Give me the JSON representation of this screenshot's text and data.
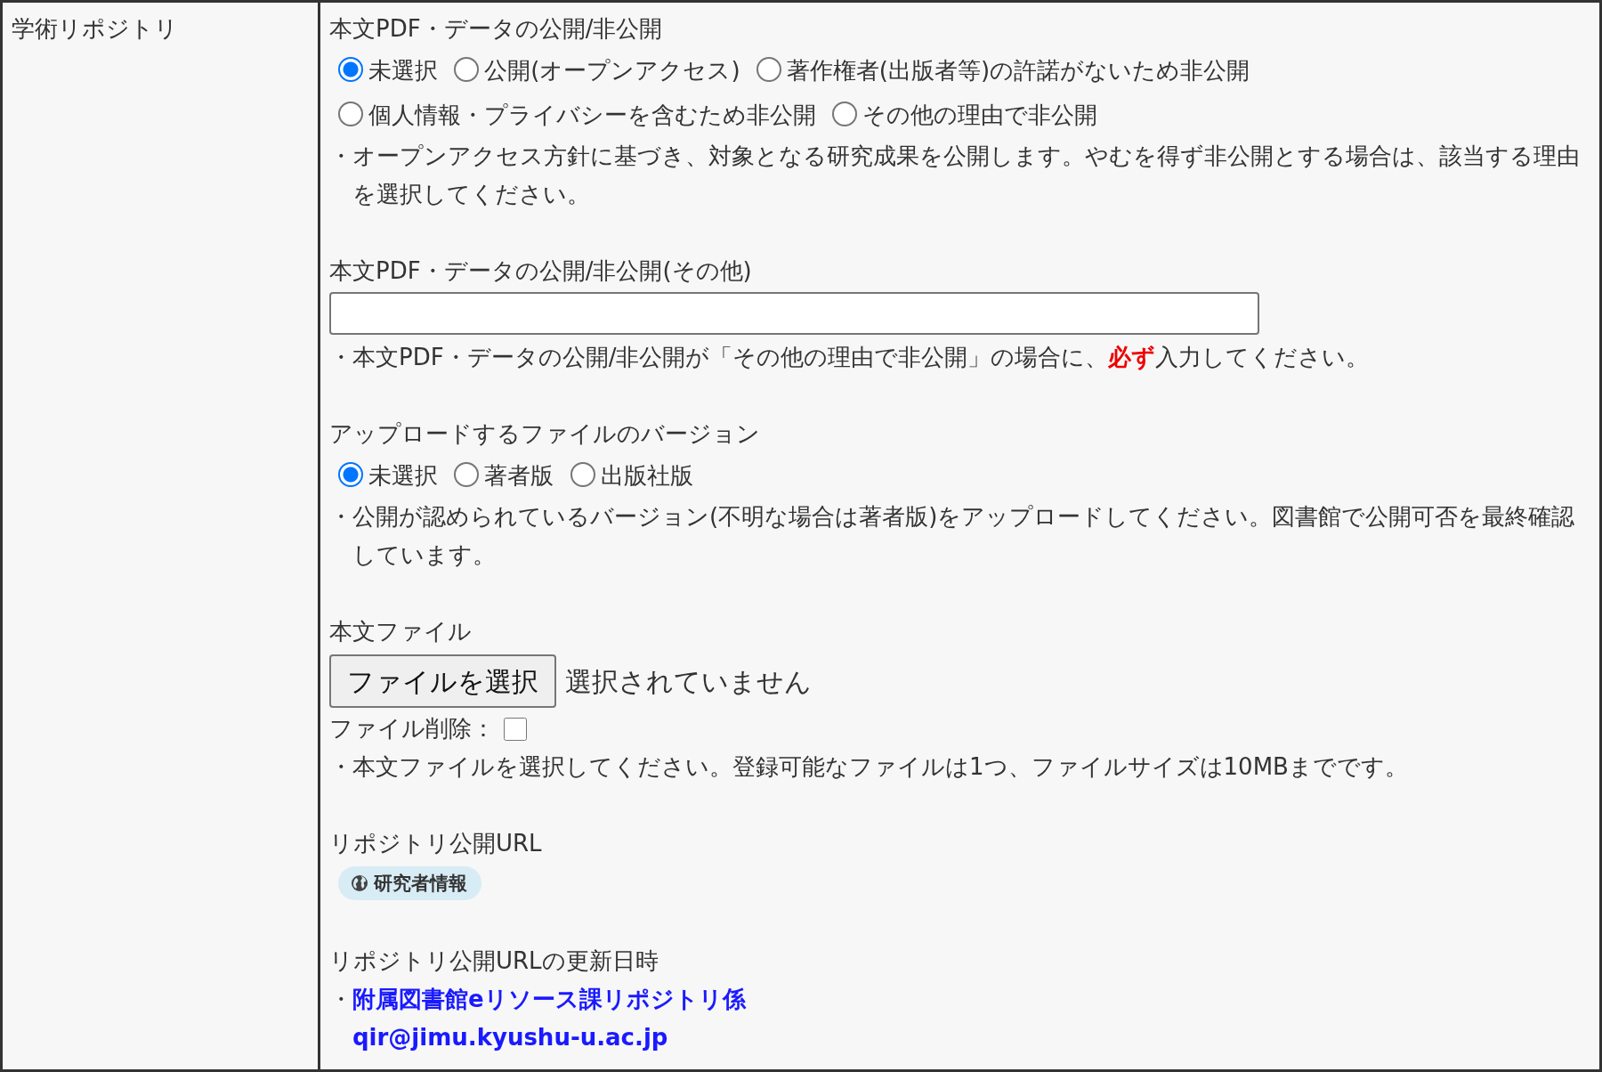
{
  "row_label": "学術リポジトリ",
  "sections": [
    {
      "kind": "radios",
      "title": "本文PDF・データの公開/非公開",
      "options": [
        {
          "label": "未選択",
          "selected": true
        },
        {
          "label": "公開(オープンアクセス)",
          "selected": false
        },
        {
          "label": "著作権者(出版者等)の許諾がないため非公開",
          "selected": false
        },
        {
          "label": "個人情報・プライバシーを含むため非公開",
          "selected": false
        },
        {
          "label": "その他の理由で非公開",
          "selected": false
        }
      ],
      "notes": [
        "・オープンアクセス方針に基づき、対象となる研究成果を公開します。やむを得ず非公開とする場合は、該当する理由を選択してください。"
      ]
    },
    {
      "kind": "text",
      "title": "本文PDF・データの公開/非公開(その他)",
      "notes": [
        "・本文PDF・データの公開/非公開が「その他の理由で非公開」の場合に、**必ず**入力してください。"
      ]
    },
    {
      "kind": "radios",
      "title": "アップロードするファイルのバージョン",
      "options": [
        {
          "label": "未選択",
          "selected": true
        },
        {
          "label": "著者版",
          "selected": false
        },
        {
          "label": "出版社版",
          "selected": false
        }
      ],
      "notes": [
        "・公開が認められているバージョン(不明な場合は著者版)をアップロードしてください。図書館で公開可否を最終確認しています。"
      ]
    },
    {
      "kind": "file",
      "title": "本文ファイル",
      "button": "ファイルを選択",
      "status": "選択されていません",
      "delete_label": "ファイル削除：",
      "delete_checked": false,
      "notes": [
        "・本文ファイルを選択してください。登録可能なファイルは1つ、ファイルサイズは10MBまでです。"
      ]
    },
    {
      "kind": "badge",
      "title": "リポジトリ公開URL",
      "badge": "研究者情報"
    },
    {
      "kind": "contact",
      "title": "リポジトリ公開URLの更新日時",
      "bullet": "・",
      "name": "附属図書館eリソース課リポジトリ係",
      "email": "qir@jimu.kyushu-u.ac.jp"
    }
  ]
}
